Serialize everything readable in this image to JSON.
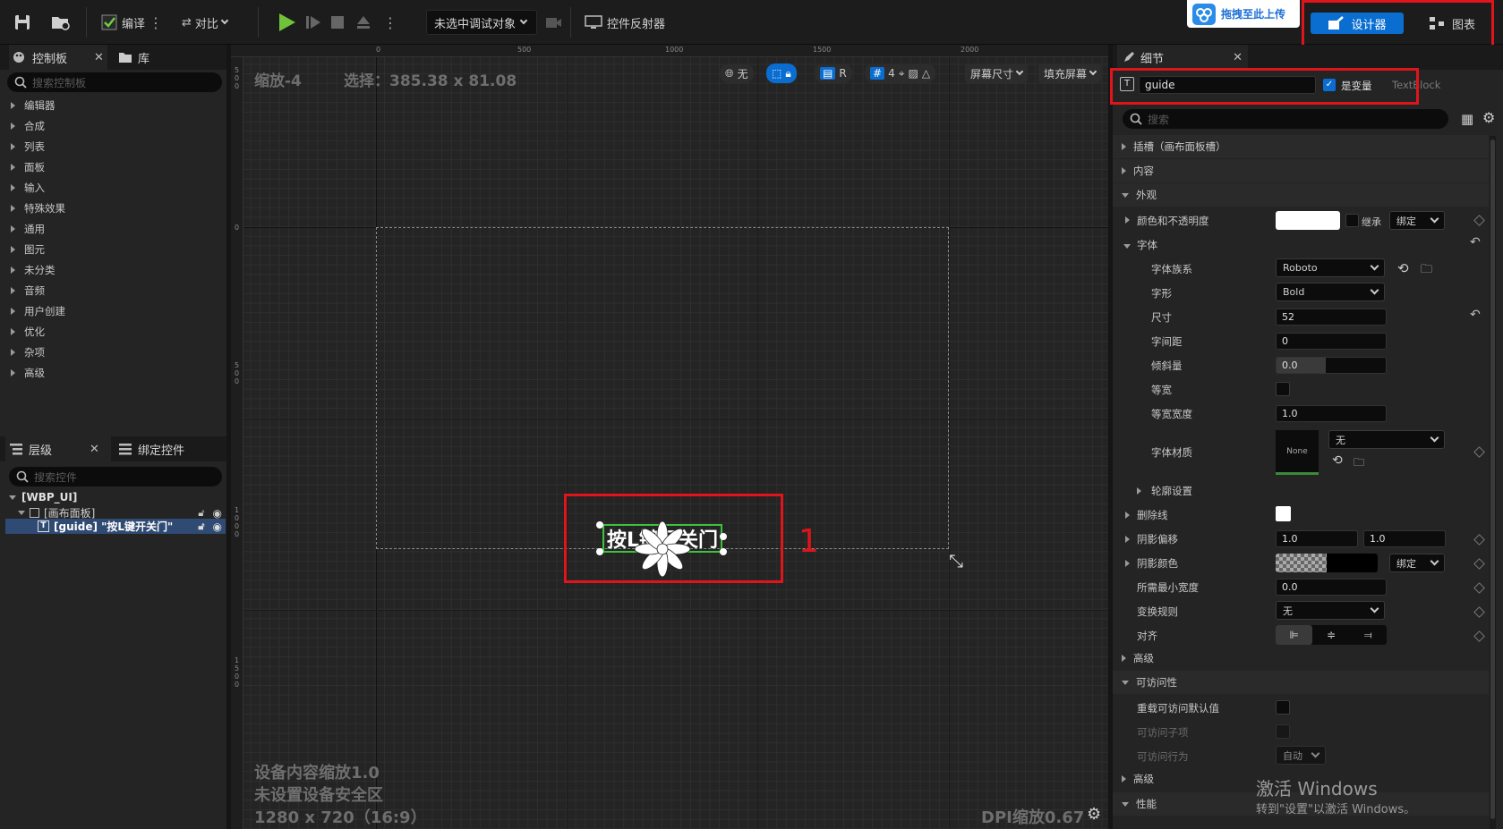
{
  "toolbar": {
    "compile_label": "编译",
    "diff_label": "对比",
    "debug_target": "未选中调试对象",
    "widget_reflector_label": "控件反射器",
    "upload_label": "拖拽至此上传",
    "designer_label": "设计器",
    "graph_label": "图表"
  },
  "palette": {
    "tab_palette": "控制板",
    "tab_library": "库",
    "search_placeholder": "搜索控制板",
    "categories": [
      "编辑器",
      "合成",
      "列表",
      "面板",
      "输入",
      "特殊效果",
      "通用",
      "图元",
      "未分类",
      "音频",
      "用户创建",
      "优化",
      "杂项",
      "高级"
    ]
  },
  "hierarchy": {
    "tab_hierarchy": "层级",
    "tab_bind": "绑定控件",
    "search_placeholder": "搜索控件",
    "root": "[WBP_UI]",
    "canvas": "[画布面板]",
    "guide": "[guide] \"按L键开关门\""
  },
  "canvas": {
    "zoom_text": "缩放-4",
    "selection_text": "选择：385.38 x 81.08",
    "ruler_top": [
      "0",
      "500",
      "1000",
      "1500",
      "2000"
    ],
    "ruler_left": [
      "5\n0\n0",
      "0",
      "5\n0\n0",
      "1\n0\n0\n0",
      "1\n5\n0\n0"
    ],
    "btn_none": "无",
    "btn_r": "R",
    "btn_grid_num": "4",
    "screen_size": "屏幕尺寸",
    "fill_screen": "填充屏幕",
    "widget_text": "按L键开关门",
    "annotation_number": "1",
    "device_scale": "设备内容缩放1.0",
    "safe_zone": "未设置设备安全区",
    "resolution": "1280 x 720（16:9）",
    "dpi": "DPI缩放0.67"
  },
  "details": {
    "tab_label": "细节",
    "name_value": "guide",
    "is_variable_label": "是变量",
    "class_label": "TextBlock",
    "search_placeholder": "搜索",
    "slot": "插槽（画布面板槽）",
    "content": "内容",
    "appearance": "外观",
    "color_opacity": "颜色和不透明度",
    "inherit": "继承",
    "bind": "绑定",
    "font": "字体",
    "font_family": "字体族系",
    "font_family_value": "Roboto",
    "typeface": "字形",
    "typeface_value": "Bold",
    "size": "尺寸",
    "size_value": "52",
    "letter_spacing": "字间距",
    "letter_spacing_value": "0",
    "skew": "倾斜量",
    "skew_value": "0.0",
    "monospace": "等宽",
    "monospace_width": "等宽宽度",
    "monospace_width_value": "1.0",
    "font_material": "字体材质",
    "font_material_thumb": "None",
    "font_material_value": "无",
    "outline": "轮廓设置",
    "strike": "删除线",
    "shadow_offset": "阴影偏移",
    "shadow_offset_x": "1.0",
    "shadow_offset_y": "1.0",
    "shadow_color": "阴影颜色",
    "min_width": "所需最小宽度",
    "min_width_value": "0.0",
    "transform_policy": "变换规则",
    "transform_policy_value": "无",
    "justification": "对齐",
    "advanced": "高级",
    "accessibility": "可访问性",
    "override_access": "重载可访问默认值",
    "access_children": "可访问子项",
    "access_behavior": "可访问行为",
    "access_behavior_value": "自动",
    "advanced2": "高级",
    "performance": "性能"
  },
  "watermark": {
    "line1": "激活 Windows",
    "line2": "转到\"设置\"以激活 Windows。"
  },
  "colors": {
    "accent": "#0a6ed1",
    "annotation": "#e0151b",
    "selection": "#3ec23e"
  }
}
